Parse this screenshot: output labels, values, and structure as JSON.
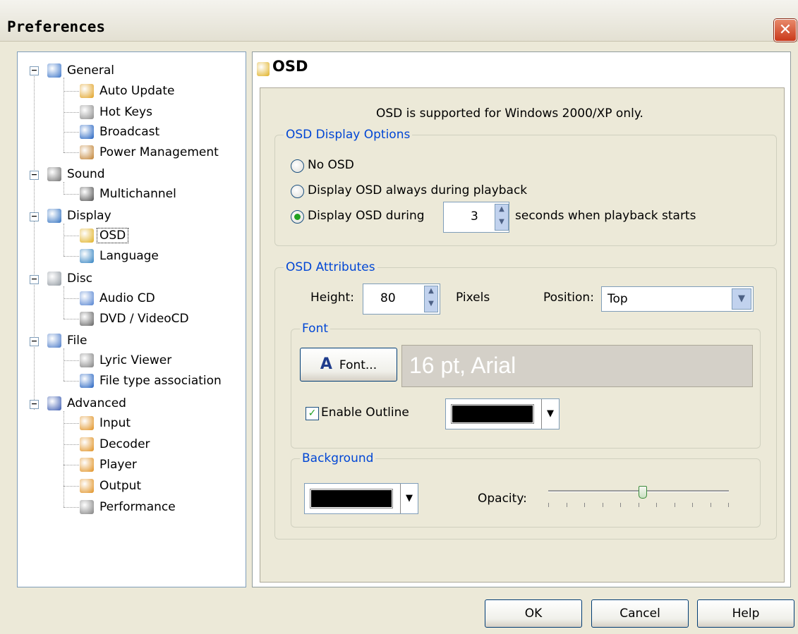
{
  "window": {
    "title": "Preferences",
    "close_glyph": "✕"
  },
  "tree": {
    "items": [
      {
        "label": "General",
        "icon": "general-icon",
        "color": "#3A74C8"
      },
      {
        "label": "Auto Update",
        "icon": "auto-update-icon",
        "color": "#E0A020"
      },
      {
        "label": "Hot Keys",
        "icon": "keyboard-icon",
        "color": "#8A8A8A"
      },
      {
        "label": "Broadcast",
        "icon": "broadcast-icon",
        "color": "#2060C0"
      },
      {
        "label": "Power Management",
        "icon": "power-management-icon",
        "color": "#C08030"
      },
      {
        "label": "Sound",
        "icon": "sound-icon",
        "color": "#707070"
      },
      {
        "label": "Multichannel",
        "icon": "multichannel-icon",
        "color": "#505050"
      },
      {
        "label": "Display",
        "icon": "display-icon",
        "color": "#3070C0"
      },
      {
        "label": "OSD",
        "icon": "osd-icon",
        "color": "#E0B020"
      },
      {
        "label": "Language",
        "icon": "language-icon",
        "color": "#2F80C0"
      },
      {
        "label": "Disc",
        "icon": "disc-icon",
        "color": "#9098A0"
      },
      {
        "label": "Audio CD",
        "icon": "audio-cd-icon",
        "color": "#5080D0"
      },
      {
        "label": "DVD / VideoCD",
        "icon": "dvd-icon",
        "color": "#606060"
      },
      {
        "label": "File",
        "icon": "file-icon",
        "color": "#4A7AC8"
      },
      {
        "label": "Lyric Viewer",
        "icon": "microphone-icon",
        "color": "#808080"
      },
      {
        "label": "File type association",
        "icon": "file-association-icon",
        "color": "#2060C0"
      },
      {
        "label": "Advanced",
        "icon": "advanced-icon",
        "color": "#3A5AB0"
      },
      {
        "label": "Input",
        "icon": "input-icon",
        "color": "#E09020"
      },
      {
        "label": "Decoder",
        "icon": "decoder-icon",
        "color": "#E09020"
      },
      {
        "label": "Player",
        "icon": "player-icon",
        "color": "#E09020"
      },
      {
        "label": "Output",
        "icon": "output-icon",
        "color": "#E09020"
      },
      {
        "label": "Performance",
        "icon": "chip-icon",
        "color": "#808080"
      }
    ]
  },
  "panel": {
    "heading": "OSD",
    "note": "OSD is supported for Windows 2000/XP only.",
    "display_options": {
      "caption": "OSD Display Options",
      "no_osd": "No OSD",
      "always": "Display OSD always during playback",
      "during": "Display OSD during",
      "seconds_value": "3",
      "seconds_suffix": "seconds when playback starts",
      "selected": "during"
    },
    "attributes": {
      "caption": "OSD Attributes",
      "height_label": "Height:",
      "height_value": "80",
      "pixels_label": "Pixels",
      "position_label": "Position:",
      "position_value": "Top",
      "font": {
        "caption": "Font",
        "button_label": "Font...",
        "preview": "16 pt, Arial",
        "enable_outline_label": "Enable Outline",
        "enable_outline_checked": true,
        "outline_color": "#000000"
      },
      "background": {
        "caption": "Background",
        "color": "#000000",
        "opacity_label": "Opacity:",
        "opacity_fraction": 0.52
      }
    }
  },
  "buttons": {
    "ok": "OK",
    "cancel": "Cancel",
    "help": "Help"
  },
  "colors": {
    "caption_blue": "#0046D5",
    "window_bg": "#ECE9D8",
    "preview_bg": "#D4D0C8",
    "preview_text": "#FFFFFF"
  }
}
